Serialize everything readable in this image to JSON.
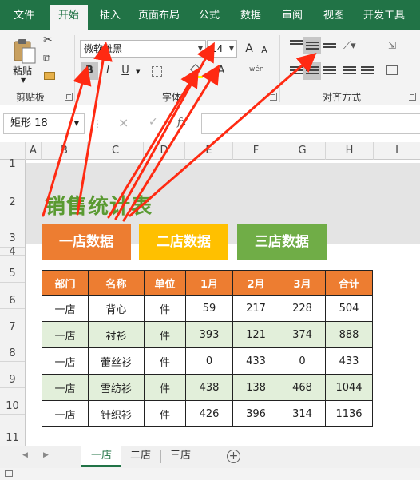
{
  "ribbon_tabs": [
    "文件",
    "开始",
    "插入",
    "页面布局",
    "公式",
    "数据",
    "审阅",
    "视图",
    "开发工具"
  ],
  "clipboard": {
    "paste_label": "粘贴",
    "group_label": "剪贴板"
  },
  "font": {
    "family": "微软雅黑",
    "size": "14",
    "group_label": "字体",
    "bold": "B",
    "italic": "I",
    "underline": "U",
    "grow": "A",
    "shrink": "A",
    "font_color": "A",
    "phonetic": "wén"
  },
  "alignment": {
    "group_label": "对齐方式"
  },
  "formula_bar": {
    "name_box": "矩形 18",
    "fx": "fx",
    "cancel": "×",
    "enter": "✓",
    "content": ""
  },
  "columns": [
    "A",
    "B",
    "C",
    "D",
    "E",
    "F",
    "G",
    "H",
    "I"
  ],
  "rows": [
    "1",
    "2",
    "3",
    "4",
    "5",
    "6",
    "7",
    "8",
    "9",
    "10",
    "11"
  ],
  "sheet_title": "销售统计表",
  "store_buttons": [
    {
      "label": "一店数据",
      "color": "#ed7d31"
    },
    {
      "label": "二店数据",
      "color": "#ffc000"
    },
    {
      "label": "三店数据",
      "color": "#70ad47"
    }
  ],
  "table": {
    "headers": [
      "部门",
      "名称",
      "单位",
      "1月",
      "2月",
      "3月",
      "合计"
    ],
    "rows": [
      [
        "一店",
        "背心",
        "件",
        "59",
        "217",
        "228",
        "504"
      ],
      [
        "一店",
        "衬衫",
        "件",
        "393",
        "121",
        "374",
        "888"
      ],
      [
        "一店",
        "蕾丝衫",
        "件",
        "0",
        "433",
        "0",
        "433"
      ],
      [
        "一店",
        "雪纺衫",
        "件",
        "438",
        "138",
        "468",
        "1044"
      ],
      [
        "一店",
        "针织衫",
        "件",
        "426",
        "396",
        "314",
        "1136"
      ]
    ]
  },
  "sheet_tabs": [
    "一店",
    "二店",
    "三店"
  ],
  "active_sheet": "一店",
  "colors": {
    "ribbon": "#217346",
    "header_fill": "#ed7d31",
    "alt_row": "#e2efda",
    "title": "#5a9a32",
    "arrow": "#ff2a12"
  }
}
